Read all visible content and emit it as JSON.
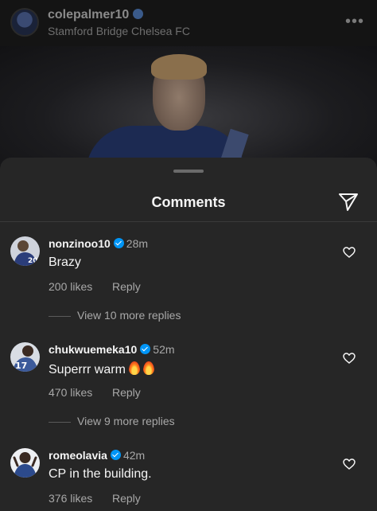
{
  "post": {
    "username": "colepalmer10",
    "location": "Stamford Bridge Chelsea FC",
    "more_label": "•••"
  },
  "comments_sheet": {
    "title": "Comments",
    "comments": [
      {
        "username": "nonzinoo10",
        "time": "28m",
        "text": "Brazy",
        "likes": "200 likes",
        "reply_label": "Reply",
        "view_replies": "View 10 more replies",
        "avatar_color": "#2b3d7a"
      },
      {
        "username": "chukwuemeka10",
        "time": "52m",
        "text": "Superrr warm",
        "likes": "470 likes",
        "reply_label": "Reply",
        "view_replies": "View 9 more replies",
        "avatar_color": "#3c5a9a"
      },
      {
        "username": "romeolavia",
        "time": "42m",
        "text": "CP in the building.",
        "likes": "376 likes",
        "reply_label": "Reply",
        "avatar_color": "#2c4a8c"
      }
    ]
  },
  "colors": {
    "sheet_bg": "#262626",
    "verified": "#0095f6",
    "muted_text": "#a8a8a8"
  }
}
